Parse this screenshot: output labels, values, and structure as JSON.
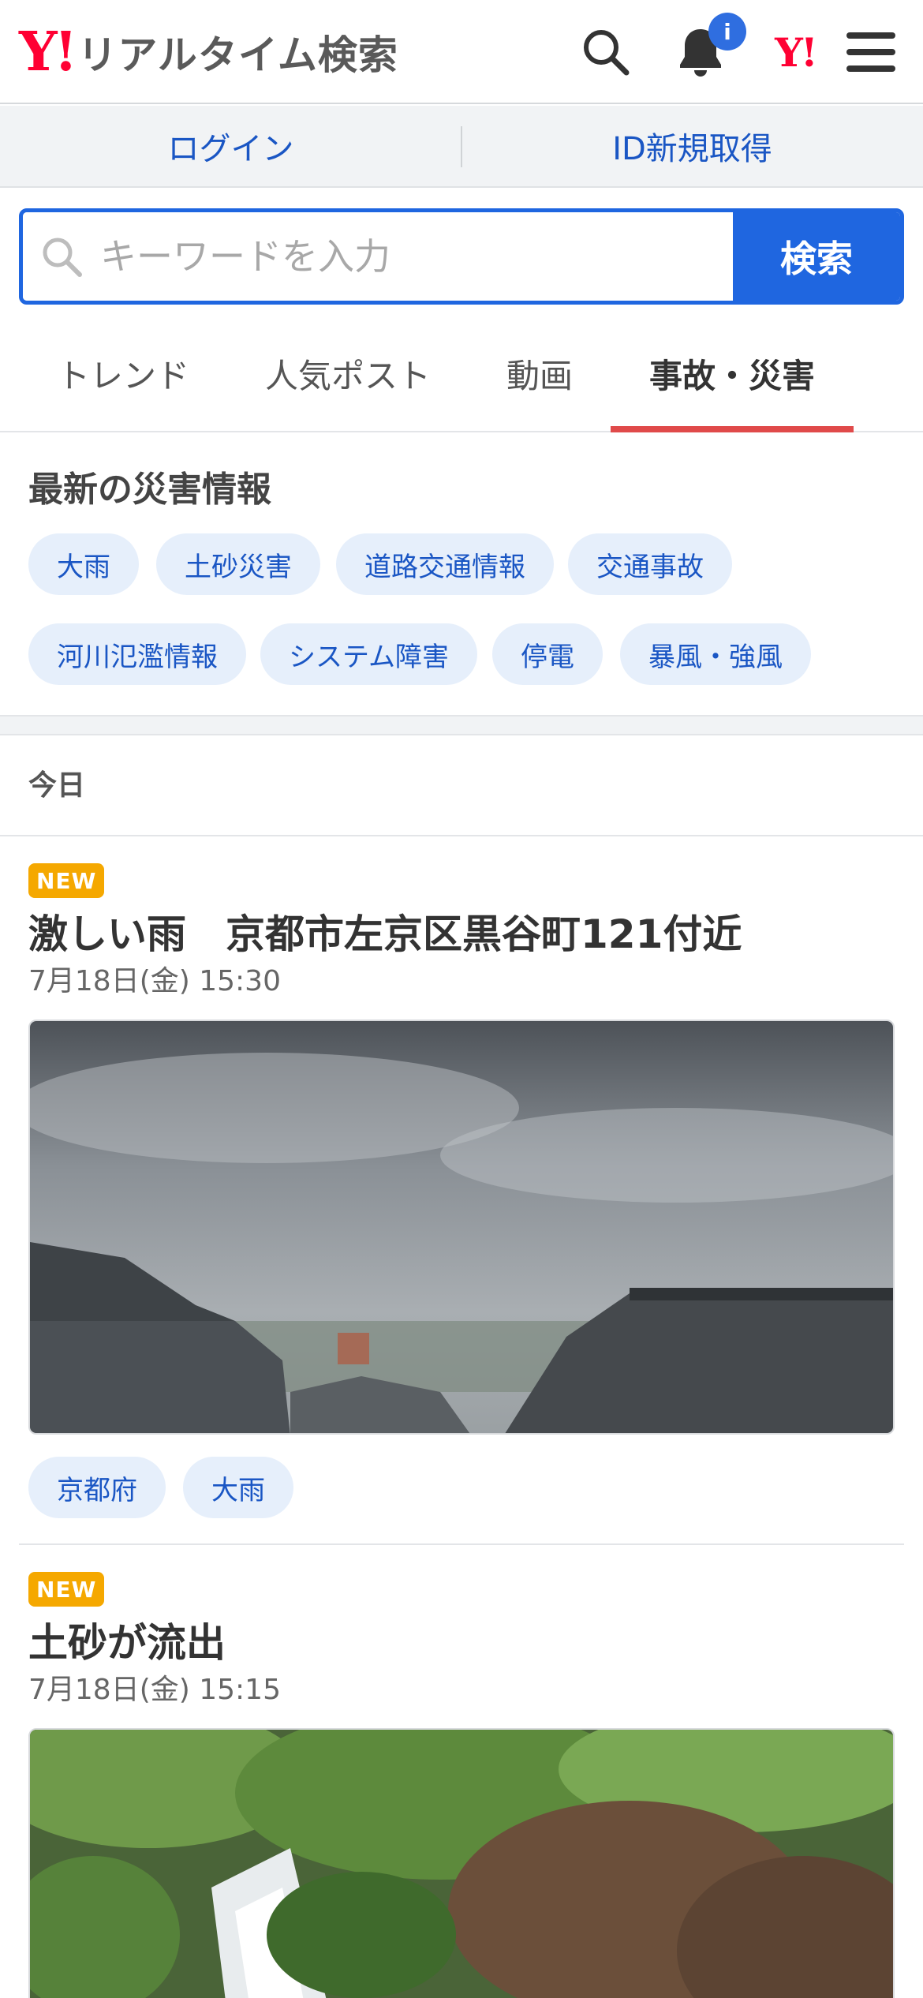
{
  "header": {
    "logo_mark": "Y!",
    "logo_text": "リアルタイム検索",
    "notification_badge": "i",
    "yj_mark": "Y!"
  },
  "auth": {
    "login_label": "ログイン",
    "signup_label": "ID新規取得"
  },
  "search": {
    "placeholder": "キーワードを入力",
    "button_label": "検索"
  },
  "tabs": [
    {
      "label": "トレンド",
      "active": false
    },
    {
      "label": "人気ポスト",
      "active": false
    },
    {
      "label": "動画",
      "active": false
    },
    {
      "label": "事故・災害",
      "active": true
    }
  ],
  "disaster": {
    "title": "最新の災害情報",
    "chips": [
      "大雨",
      "土砂災害",
      "道路交通情報",
      "交通事故",
      "河川氾濫情報",
      "システム障害",
      "停電",
      "暴風・強風"
    ]
  },
  "feed": {
    "section_label": "今日",
    "posts": [
      {
        "badge": "NEW",
        "title": "激しい雨　京都市左京区黒谷町121付近",
        "time": "7月18日(金) 15:30",
        "image": "rain-rooftops-photo",
        "tags": [
          "京都府",
          "大雨"
        ]
      },
      {
        "badge": "NEW",
        "title": "土砂が流出",
        "time": "7月18日(金) 15:15",
        "image": "landslide-water-photo",
        "tags": []
      }
    ]
  },
  "colors": {
    "brand_red": "#ff0033",
    "accent_blue": "#1f66e0",
    "link_blue": "#1a56c4",
    "active_tab_underline": "#e04a4a",
    "new_badge": "#f5a800",
    "chip_bg": "#e6effb"
  }
}
